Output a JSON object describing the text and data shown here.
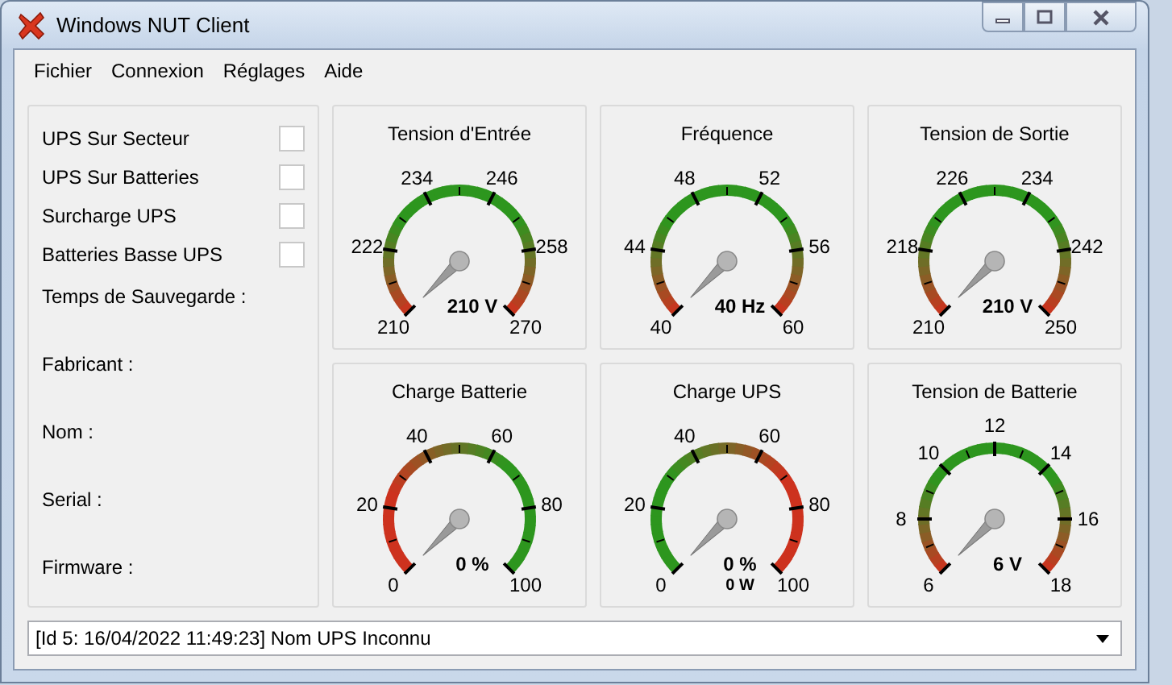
{
  "window": {
    "title": "Windows NUT Client"
  },
  "menu": [
    "Fichier",
    "Connexion",
    "Réglages",
    "Aide"
  ],
  "status_indicators": [
    {
      "label": "UPS Sur Secteur",
      "checked": false
    },
    {
      "label": "UPS Sur Batteries",
      "checked": false
    },
    {
      "label": "Surcharge UPS",
      "checked": false
    },
    {
      "label": "Batteries Basse UPS",
      "checked": false
    }
  ],
  "info_fields": [
    "Temps de Sauvegarde :",
    "Fabricant :",
    "Nom :",
    "Serial :",
    "Firmware :"
  ],
  "gauges": [
    {
      "title": "Tension d'Entrée",
      "kind": "ends-bad",
      "labels": [
        "210",
        "222",
        "234",
        "246",
        "258",
        "270"
      ],
      "reading": "210 V"
    },
    {
      "title": "Fréquence",
      "kind": "ends-bad",
      "labels": [
        "40",
        "44",
        "48",
        "52",
        "56",
        "60"
      ],
      "reading": "40 Hz"
    },
    {
      "title": "Tension de Sortie",
      "kind": "ends-bad",
      "labels": [
        "210",
        "218",
        "226",
        "234",
        "242",
        "250"
      ],
      "reading": "210 V"
    },
    {
      "title": "Charge Batterie",
      "kind": "low-bad",
      "labels": [
        "0",
        "20",
        "40",
        "60",
        "80",
        "100"
      ],
      "reading": "0 %"
    },
    {
      "title": "Charge UPS",
      "kind": "high-bad",
      "labels": [
        "0",
        "20",
        "40",
        "60",
        "80",
        "100"
      ],
      "reading": "0 %",
      "sub_reading": "0 W"
    },
    {
      "title": "Tension de Batterie",
      "kind": "ends-bad",
      "labels": [
        "6",
        "8",
        "10",
        "12",
        "14",
        "16",
        "18"
      ],
      "reading": "6 V"
    }
  ],
  "log_dropdown": {
    "value": "[Id 5: 16/04/2022 11:49:23] Nom UPS Inconnu"
  }
}
